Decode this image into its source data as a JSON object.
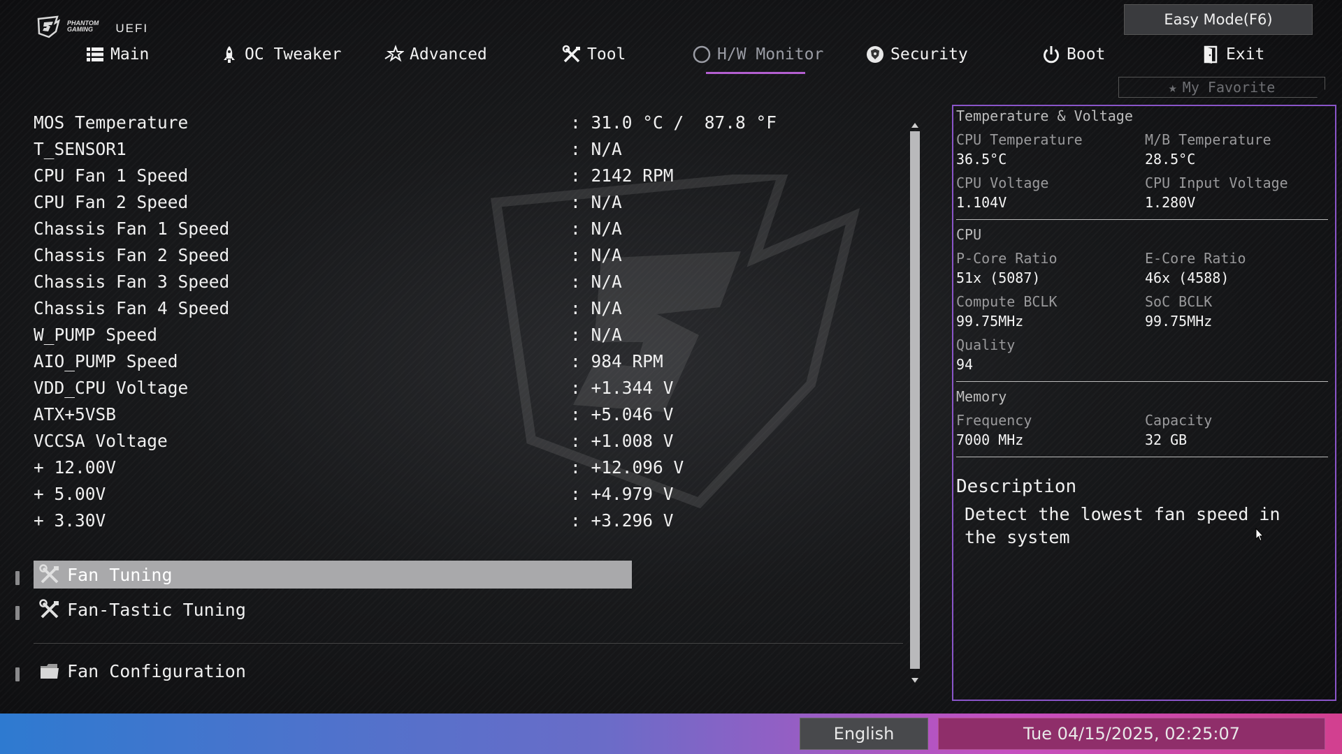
{
  "header": {
    "brand_line1": "PHANTOM",
    "brand_line2": "GAMING",
    "uefi": "UEFI",
    "easy_mode": "Easy Mode(F6)",
    "favorite": "My Favorite"
  },
  "tabs": [
    {
      "label": "Main",
      "icon": "list-icon"
    },
    {
      "label": "OC Tweaker",
      "icon": "rocket-icon"
    },
    {
      "label": "Advanced",
      "icon": "star-swoosh-icon"
    },
    {
      "label": "Tool",
      "icon": "tools-icon"
    },
    {
      "label": "H/W Monitor",
      "icon": "monitor-circle-icon",
      "active": true
    },
    {
      "label": "Security",
      "icon": "shield-icon"
    },
    {
      "label": "Boot",
      "icon": "power-icon"
    },
    {
      "label": "Exit",
      "icon": "door-icon"
    }
  ],
  "items": [
    {
      "label": "MOS Temperature",
      "value": ": 31.0 °C /  87.8 °F"
    },
    {
      "label": "T_SENSOR1",
      "value": ": N/A"
    },
    {
      "label": "CPU Fan 1 Speed",
      "value": ": 2142 RPM"
    },
    {
      "label": "CPU Fan 2 Speed",
      "value": ": N/A"
    },
    {
      "label": "Chassis Fan 1 Speed",
      "value": ": N/A"
    },
    {
      "label": "Chassis Fan 2 Speed",
      "value": ": N/A"
    },
    {
      "label": "Chassis Fan 3 Speed",
      "value": ": N/A"
    },
    {
      "label": "Chassis Fan 4 Speed",
      "value": ": N/A"
    },
    {
      "label": "W_PUMP Speed",
      "value": ": N/A"
    },
    {
      "label": "AIO_PUMP Speed",
      "value": ": 984 RPM"
    },
    {
      "label": "VDD_CPU Voltage",
      "value": ": +1.344 V"
    },
    {
      "label": "ATX+5VSB",
      "value": ": +5.046 V"
    },
    {
      "label": "VCCSA Voltage",
      "value": ": +1.008 V"
    },
    {
      "label": "+ 12.00V",
      "value": ": +12.096 V"
    },
    {
      "label": "+ 5.00V",
      "value": ": +4.979 V"
    },
    {
      "label": "+ 3.30V",
      "value": ": +3.296 V"
    }
  ],
  "submenus": {
    "fan_tuning": "Fan Tuning",
    "fan_tastic": "Fan-Tastic Tuning",
    "fan_config": "Fan Configuration"
  },
  "panel": {
    "section_tv": "Temperature & Voltage",
    "cpu_temp_label": "CPU Temperature",
    "cpu_temp": "36.5°C",
    "mb_temp_label": "M/B Temperature",
    "mb_temp": "28.5°C",
    "cpu_volt_label": "CPU Voltage",
    "cpu_volt": "1.104V",
    "cpu_in_volt_label": "CPU Input Voltage",
    "cpu_in_volt": "1.280V",
    "section_cpu": "CPU",
    "pcore_label": "P-Core Ratio",
    "pcore": "51x (5087)",
    "ecore_label": "E-Core Ratio",
    "ecore": "46x (4588)",
    "compute_bclk_label": "Compute BCLK",
    "compute_bclk": "99.75MHz",
    "soc_bclk_label": "SoC BCLK",
    "soc_bclk": "99.75MHz",
    "quality_label": "Quality",
    "quality": "94",
    "section_mem": "Memory",
    "freq_label": "Frequency",
    "freq": "7000 MHz",
    "cap_label": "Capacity",
    "cap": "32 GB",
    "desc_title": "Description",
    "desc_text": "Detect the lowest fan speed in the system"
  },
  "footer": {
    "language": "English",
    "datetime": "Tue 04/15/2025, 02:25:07"
  },
  "colors": {
    "accent": "#b35fd0",
    "panel_border": "#8a55c9",
    "selected_row": "#a9a9ab"
  }
}
